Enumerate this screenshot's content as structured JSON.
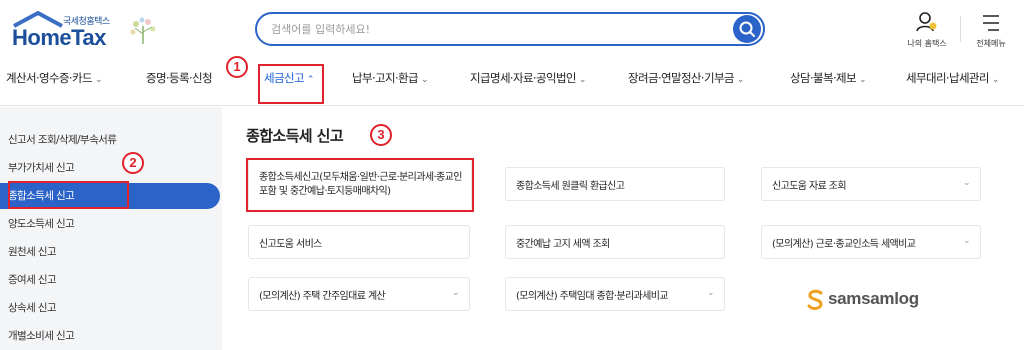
{
  "header": {
    "logo_sub": "국세청홈택스",
    "logo_main": "HomeTax",
    "search_placeholder": "검색어를 입력하세요!",
    "my_hometax": "나의 홈택스",
    "all_menu": "전체메뉴"
  },
  "nav": {
    "items": [
      {
        "label": "계산서·영수증·카드",
        "chevron": "⌄"
      },
      {
        "label": "증명·등록·신청",
        "chevron": ""
      },
      {
        "label": "세금신고",
        "chevron": "⌃"
      },
      {
        "label": "납부·고지·환급",
        "chevron": "⌄"
      },
      {
        "label": "지급명세·자료·공익법인",
        "chevron": "⌄"
      },
      {
        "label": "장려금·연말정산·기부금",
        "chevron": "⌄"
      },
      {
        "label": "상담·불복·제보",
        "chevron": "⌄"
      },
      {
        "label": "세무대리·납세관리",
        "chevron": "⌄"
      }
    ]
  },
  "annotations": {
    "step1": "1",
    "step2": "2",
    "step3": "3"
  },
  "sidebar": {
    "items": [
      {
        "label": "신고서 조회/삭제/부속서류"
      },
      {
        "label": "부가가치세 신고"
      },
      {
        "label": "종합소득세 신고"
      },
      {
        "label": "양도소득세 신고"
      },
      {
        "label": "원천세 신고"
      },
      {
        "label": "증여세 신고"
      },
      {
        "label": "상속세 신고"
      },
      {
        "label": "개별소비세 신고"
      }
    ]
  },
  "main": {
    "title": "종합소득세 신고",
    "cards": [
      {
        "label": "종합소득세신고(모두채움·일반·근로·분리과세·종교인포함 및 중간예납·토지등매매차익)"
      },
      {
        "label": "종합소득세 원클릭 환급신고"
      },
      {
        "label": "신고도움 자료 조회",
        "chevron": "⌄"
      },
      {
        "label": "신고도움 서비스"
      },
      {
        "label": "중간예납 고지 세액 조회"
      },
      {
        "label": "(모의계산) 근로·종교인소득 세액비교",
        "chevron": "⌄"
      },
      {
        "label": "(모의계산) 주택 간주임대료 계산",
        "chevron": "⌄"
      },
      {
        "label": "(모의계산) 주택임대 종합·분리과세비교",
        "chevron": "⌄"
      }
    ]
  },
  "brand": {
    "name": "samsamlog"
  },
  "colors": {
    "accent": "#2b63c9",
    "annotation": "#e0222c",
    "sidebar_bg": "#f4f5f7"
  }
}
